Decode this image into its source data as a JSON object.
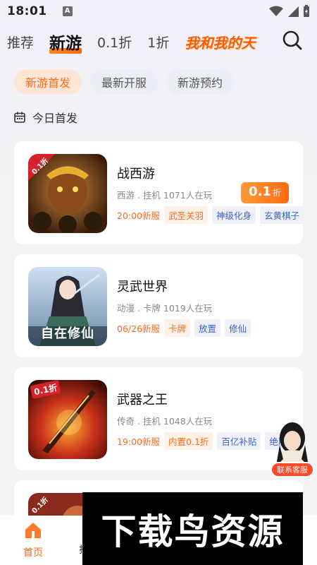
{
  "status_bar": {
    "time": "18:01",
    "notif_letter": "A"
  },
  "top_nav": {
    "tabs": [
      {
        "label": "推荐"
      },
      {
        "label": "新游"
      },
      {
        "label": "0.1折"
      },
      {
        "label": "1折"
      }
    ],
    "promo_text": "我和我的天",
    "active_index": 1
  },
  "sub_tabs": [
    {
      "label": "新游首发"
    },
    {
      "label": "最新开服"
    },
    {
      "label": "新游预约"
    }
  ],
  "section_title": "今日首发",
  "games": [
    {
      "name": "战西游",
      "meta": "西游 . 挂机 1071人在玩",
      "time": "20:00新服",
      "tags": [
        {
          "text": "武圣关羽",
          "style": "orange"
        },
        {
          "text": "神级化身",
          "style": "blue"
        },
        {
          "text": "玄黄棋子",
          "style": "blue"
        }
      ],
      "thumb_badge": "0.1折",
      "discount": {
        "num": "0.1",
        "unit": "折"
      }
    },
    {
      "name": "灵武世界",
      "meta": "动漫 . 卡牌 1019人在玩",
      "time": "06/26新服",
      "tags": [
        {
          "text": "卡牌",
          "style": "orange"
        },
        {
          "text": "放置",
          "style": "blue"
        },
        {
          "text": "修仙",
          "style": "blue"
        }
      ],
      "thumb_text": "自在修仙"
    },
    {
      "name": "武器之王",
      "meta": "传奇 . 挂机 1048人在玩",
      "time": "19:00新服",
      "tags": [
        {
          "text": "内置0.1折",
          "style": "orange"
        },
        {
          "text": "百亿补贴",
          "style": "blue"
        },
        {
          "text": "绝版",
          "style": "blue"
        }
      ],
      "thumb_badge": "0.1折"
    },
    {
      "thumb_badge": "0.1折"
    }
  ],
  "customer_service": {
    "label": "联系客服"
  },
  "bottom_nav": {
    "home_label": "首页",
    "second_label_partial": "折"
  },
  "watermark": "下载鸟资源",
  "colors": {
    "accent": "#ff6a1a",
    "tag_blue": "#3c64c8",
    "badge_red": "#ff4a2a"
  }
}
